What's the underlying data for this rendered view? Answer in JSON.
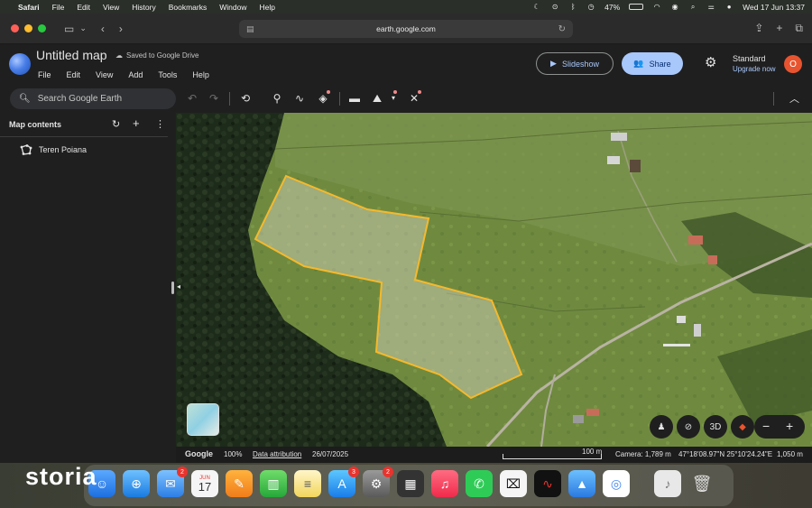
{
  "menubar": {
    "app": "Safari",
    "items": [
      "File",
      "Edit",
      "View",
      "History",
      "Bookmarks",
      "Window",
      "Help"
    ],
    "battery": "47%",
    "datetime": "Wed 17 Jun  13:37"
  },
  "safari": {
    "url": "earth.google.com"
  },
  "header": {
    "title": "Untitled map",
    "saved_status": "Saved to Google Drive",
    "menu": [
      "File",
      "Edit",
      "View",
      "Add",
      "Tools",
      "Help"
    ],
    "slideshow_label": "Slideshow",
    "share_label": "Share",
    "plan_name": "Standard",
    "upgrade_label": "Upgrade now",
    "avatar_initial": "O"
  },
  "toolbar": {
    "search_placeholder": "Search Google Earth"
  },
  "panel": {
    "title": "Map contents",
    "layers": [
      {
        "name": "Teren Poiana"
      }
    ]
  },
  "map": {
    "attribution_brand": "Google",
    "zoom_level": "100%",
    "data_attribution": "Data attribution",
    "imagery_date": "26/07/2025",
    "scale_label": "100 m",
    "camera": "Camera: 1,789 m",
    "coordinates": "47°18'08.97\"N 25°10'24.24\"E",
    "elevation": "1,050 m",
    "view_3d_label": "3D",
    "polygon_color": "#f5b92c"
  },
  "dock": {
    "overlay_text": "storia",
    "calendar_month": "JUN",
    "calendar_day": "17",
    "mail_badge": "2",
    "appstore_badge": "3",
    "settings_badge": "2"
  }
}
